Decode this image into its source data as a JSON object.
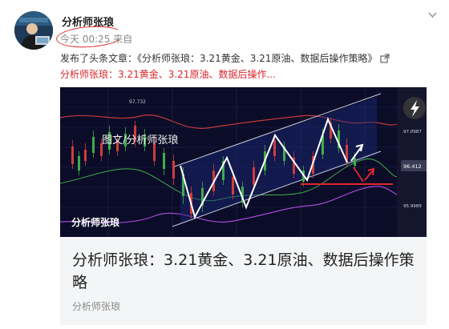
{
  "author": {
    "name": "分析师张琅"
  },
  "post": {
    "time": "今天 00:25 来自",
    "action": "发布了头条文章：《分析师张琅：3.21黄金、3.21原油、数据后操作策略》",
    "preview_link": "分析师张琅：3.21黄金、3.21原油、数据后操作..."
  },
  "article": {
    "image": {
      "watermark": "图文/分析师张琅",
      "brand": "分析师张琅",
      "price_labels": [
        "97.732",
        "97.0987",
        "96.412",
        "95.9989"
      ]
    },
    "title": "分析师张琅：3.21黄金、3.21原油、数据后操作策略",
    "source": "分析师张琅"
  },
  "icons": {
    "menu": "chevron-down-icon",
    "external": "external-link-icon",
    "flash": "lightning-icon"
  },
  "colors": {
    "accent_red": "#d9262c",
    "chart_bg": "#0b0c28",
    "title_text": "#222222",
    "muted_text": "#888888"
  }
}
